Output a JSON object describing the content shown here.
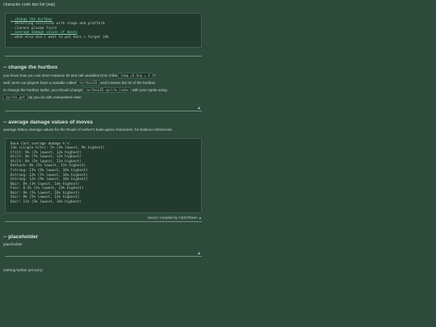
{
  "page_title": "character code tips list (wip)",
  "toc": {
    "items": [
      {
        "text": "- change the hurtbox",
        "link": true
      },
      {
        "text": "- detecting collision with stage and platform",
        "link": false
      },
      {
        "text": "- clarent plasma field",
        "link": false
      },
      {
        "text": "- average damage values of moves",
        "link": true
      },
      {
        "text": "- what else did i want to put here i forget idk",
        "link": false
      }
    ]
  },
  "back_to_top": "▲",
  "sections": {
    "hurtbox": {
      "heading": "-- change the hurtbox",
      "p1a": "you know how you can store instance ID and call variables from it like",
      "p1code": "temp_id.hsp = 4",
      "p1b": "?",
      "p2a": "well, turns out players have a variable called",
      "p2code": "hurtboxID",
      "p2b": "and it stores the ID of the hurtbox",
      "p3a": "to change the hurtbox sprite, you should change",
      "p3code": "hurtboxID.sprite_index",
      "p3b": "with your sprite using",
      "p4code": "sprite_get",
      "p4b": "as you do with everywhere else!"
    },
    "damage": {
      "heading": "-- average damage values of moves",
      "intro": "average hitbox damage values for the Rivals of Aether's base-game characters, for balance references.",
      "code_lines": [
        "Base Cast average damage %'s:",
        "Jab (single hits): 5% (3% lowest, 9% highest)",
        "Ftilt: 9% (7% lowest, 13% highest)",
        "Dtilt: 8% (7% lowest, 12% highest)",
        "Utilt: 8% (5% lowest, 11% highest)",
        "Dattack: 8% (5% lowest, 11% highest)",
        "Fstrong: 13% (9% lowest, 16% highest)",
        "Dstrong: 12% (7% lowest, 16% highest)",
        "Ustrong: 12% (9% lowest, 16% highest)",
        "Nair: 8% (3% lowest, 14% highest)",
        "Fair: 8.5% (5% lowest, 13% highest)",
        "Bair: 9% (5% lowest, 16% highest)",
        "Uair: 8% (5% lowest, 13% highest)",
        "Dair: 11% (5% lowest, 16% highest)"
      ],
      "source": "source: compiled by ArtistOfSeen"
    },
    "placeholder": {
      "heading": "-- placeholder",
      "text": "placeholder"
    }
  },
  "footer_text": "nothing further yet sorry"
}
